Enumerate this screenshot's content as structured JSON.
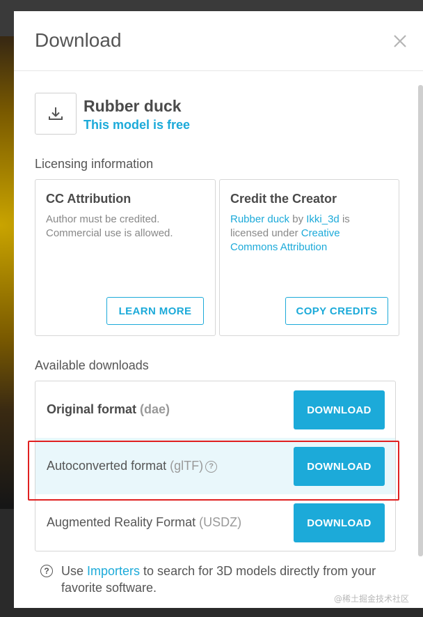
{
  "modal": {
    "title": "Download",
    "close_icon": "close-icon"
  },
  "model": {
    "icon": "download-icon",
    "name": "Rubber duck",
    "status": "This model is free"
  },
  "licensing": {
    "section_label": "Licensing information",
    "license_card": {
      "title": "CC Attribution",
      "text": "Author must be credited. Commercial use is allowed.",
      "button": "LEARN MORE"
    },
    "credit_card": {
      "title": "Credit the Creator",
      "model_link": "Rubber duck",
      "by_text": " by ",
      "author_link": "Ikki_3d",
      "licensed_text": " is licensed under ",
      "license_link": "Creative Commons Attribution",
      "button": "COPY CREDITS"
    }
  },
  "downloads": {
    "section_label": "Available downloads",
    "items": [
      {
        "label": "Original format",
        "format": "(dae)",
        "button": "DOWNLOAD"
      },
      {
        "label": "Autoconverted format",
        "format": "(glTF)",
        "help_icon": "help-circle-icon",
        "help_glyph": "?",
        "button": "DOWNLOAD"
      },
      {
        "label": "Augmented Reality Format",
        "format": "(USDZ)",
        "button": "DOWNLOAD"
      }
    ]
  },
  "footer": {
    "icon": "help-circle-icon",
    "icon_glyph": "?",
    "prefix": "Use ",
    "link": "Importers",
    "suffix": " to search for 3D models directly from your favorite software."
  },
  "watermark": "@稀土掘金技术社区",
  "colors": {
    "accent": "#1caad9",
    "highlight_row": "#e9f7fb",
    "annotation_frame": "#e02020"
  }
}
